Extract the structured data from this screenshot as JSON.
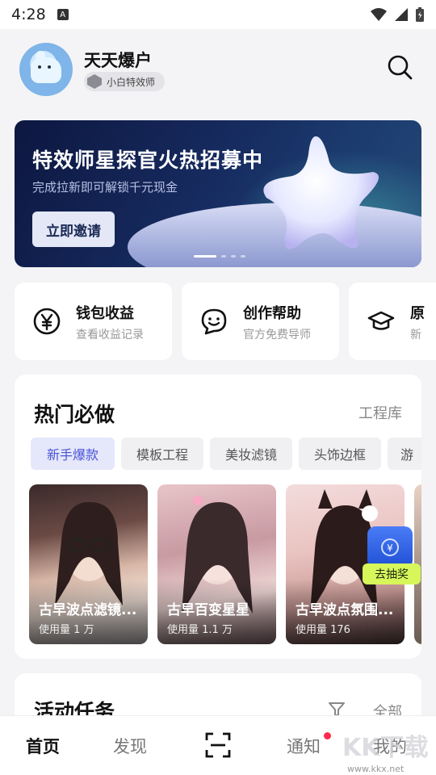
{
  "status_bar": {
    "time": "4:28",
    "notification_icon": "A"
  },
  "header": {
    "user_name": "天天爆户",
    "badge_label": "小白特效师",
    "icons": [
      "avatar",
      "gem-icon",
      "search-icon"
    ]
  },
  "banner": {
    "title": "特效师星探官火热招募中",
    "subtitle": "完成拉新即可解锁千元现金",
    "cta_label": "立即邀请",
    "page_count": 4,
    "active_page": 1
  },
  "quick_links": [
    {
      "title": "钱包收益",
      "subtitle": "查看收益记录",
      "icon": "yen-icon"
    },
    {
      "title": "创作帮助",
      "subtitle": "官方免费导师",
      "icon": "chat-smile-icon"
    },
    {
      "title": "原",
      "subtitle": "新",
      "icon": "graduation-cap-icon"
    }
  ],
  "hot": {
    "title": "热门必做",
    "more_label": "工程库",
    "tabs": [
      {
        "label": "新手爆款",
        "active": true
      },
      {
        "label": "模板工程",
        "active": false
      },
      {
        "label": "美妆滤镜",
        "active": false
      },
      {
        "label": "头饰边框",
        "active": false
      },
      {
        "label": "游",
        "active": false
      }
    ],
    "cards": [
      {
        "title": "古早波点滤镜...",
        "usage": "使用量 1 万"
      },
      {
        "title": "古早百变星星",
        "usage": "使用量 1.1 万"
      },
      {
        "title": "古早波点氛围...",
        "usage": "使用量 176"
      }
    ],
    "lottery_label": "去抽奖"
  },
  "tasks": {
    "title": "活动任务",
    "filter_label": "全部"
  },
  "bottom_nav": [
    {
      "label": "首页",
      "active": true
    },
    {
      "label": "发现",
      "active": false
    },
    {
      "label": "",
      "icon": "scan-icon",
      "active": false
    },
    {
      "label": "通知",
      "active": false,
      "has_dot": true
    },
    {
      "label": "我的",
      "active": false
    }
  ],
  "watermark": {
    "text": "KK下载",
    "url": "www.kkx.net"
  },
  "colors": {
    "accent": "#4a55d6",
    "notification_dot": "#ff2a4d",
    "lottery": "#d6f65a"
  }
}
